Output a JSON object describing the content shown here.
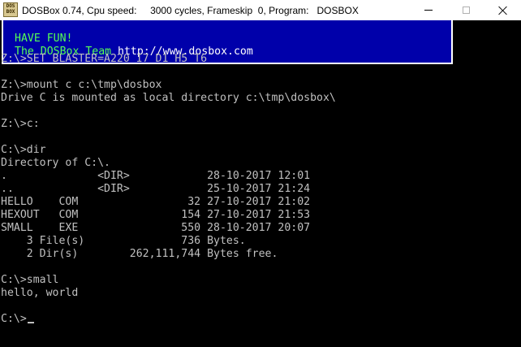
{
  "window": {
    "title": "DOSBox 0.74, Cpu speed:     3000 cycles, Frameskip  0, Program:   DOSBOX",
    "icon_label": "DOS BOX",
    "minimize_icon": "minimize-icon",
    "maximize_icon": "maximize-icon",
    "close_icon": "close-icon"
  },
  "banner": {
    "line1": "HAVE FUN!",
    "line2_prefix": "The DOSBox Team ",
    "line2_url": "http://www.dosbox.com"
  },
  "colors": {
    "banner_bg": "#0000aa",
    "banner_text": "#55ff55",
    "console_text": "#c0c0c0",
    "console_bg": "#000000"
  },
  "terminal": {
    "lines": [
      "Z:\\>SET BLASTER=A220 I7 D1 H5 T6",
      "",
      "Z:\\>mount c c:\\tmp\\dosbox",
      "Drive C is mounted as local directory c:\\tmp\\dosbox\\",
      "",
      "Z:\\>c:",
      "",
      "C:\\>dir",
      "Directory of C:\\.",
      ".              <DIR>            28-10-2017 12:01",
      "..             <DIR>            25-10-2017 21:24",
      "HELLO    COM                 32 27-10-2017 21:02",
      "HEXOUT   COM                154 27-10-2017 21:53",
      "SMALL    EXE                550 28-10-2017 20:07",
      "    3 File(s)               736 Bytes.",
      "    2 Dir(s)        262,111,744 Bytes free.",
      "",
      "C:\\>small",
      "hello, world",
      "",
      "C:\\>"
    ]
  }
}
